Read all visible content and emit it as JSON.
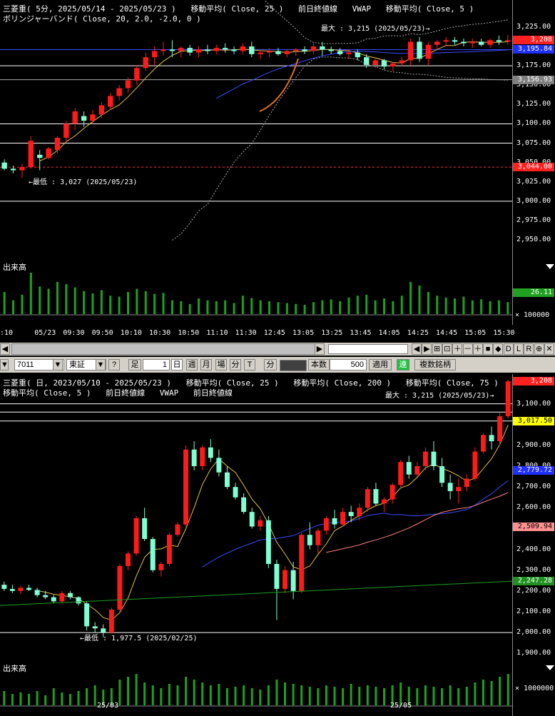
{
  "colors": {
    "up": "#ff1a1a",
    "down": "#7fffd4",
    "ma5": "#e6c050",
    "ma25": "#3a4cff",
    "ma75": "#ff8080",
    "ma200": "#1e9e1e",
    "vol": "#1ea01e",
    "axis": "#ffffff"
  },
  "top": {
    "header1": [
      "三菱重( 5分, 2025/05/14 - 2025/05/23 )",
      "移動平均( Close, 25 )",
      "前日終値線",
      "VWAP",
      "移動平均( Close, 5 )"
    ],
    "header2": "ボリンジャーバンド( Close, 20, 2.0, -2.0, 0 )",
    "max_note": "最大 : 3,215 (2025/05/23)→",
    "min_note": "←最低 : 3,027 (2025/05/23)",
    "yticks": [
      "3,225.00",
      "3,175.00",
      "3,150.00",
      "3,125.00",
      "3,100.00",
      "3,075.00",
      "3,050.00",
      "3,025.00",
      "3,000.00",
      "2,975.00",
      "2,950.00"
    ],
    "tags": [
      {
        "text": "3,208",
        "bg": "#ff2020",
        "fg": "#fff"
      },
      {
        "text": "3,195.84",
        "bg": "#2030ff",
        "fg": "#fff"
      },
      {
        "text": "3,156.93",
        "bg": "#808080",
        "fg": "#fff"
      },
      {
        "text": "3,044.00",
        "bg": "#ff2020",
        "fg": "#fff"
      }
    ],
    "xticks": [
      ":10",
      "05/23",
      "09:30",
      "09:50",
      "10:10",
      "10:30",
      "10:50",
      "11:10",
      "11:30",
      "12:45",
      "13:05",
      "13:25",
      "13:45",
      "14:05",
      "14:25",
      "14:45",
      "15:05",
      "15:30"
    ],
    "volume_label": "出来高",
    "volume_tag": "26.11",
    "volume_scale": "× 100000"
  },
  "toolbar": {
    "nav": [
      "◀",
      "▶",
      "⊞",
      "⊡",
      "＋",
      "－",
      "＋",
      "■",
      "◆",
      "D",
      "L",
      "R",
      "⊕",
      "✕"
    ],
    "code": "7011",
    "market": "東証",
    "help": "?",
    "ashi": "足",
    "count": "1",
    "day": "日",
    "week": "週",
    "month": "月",
    "ba": "場",
    "minute": "分",
    "tick": "T",
    "bun": "分",
    "honsu": "本数",
    "honsu_val": "500",
    "apply": "適用",
    "ren": "連",
    "multi": "複数銘柄"
  },
  "bottom": {
    "header1": [
      "三菱重( 日, 2023/05/10 - 2025/05/23 )",
      "移動平均( Close, 25 )",
      "移動平均( Close, 200 )",
      "移動平均( Close, 75 )"
    ],
    "header2": [
      "移動平均( Close, 5 )",
      "前日終値線",
      "VWAP",
      "前日終値線"
    ],
    "max_note": "最大 : 3,215 (2025/05/23)→",
    "min_note": "←最低 : 1,977.5 (2025/02/25)",
    "yticks": [
      "3,100.00",
      "2,900.00",
      "2,800.00",
      "2,700.00",
      "2,600.00",
      "2,500.00",
      "2,400.00",
      "2,300.00",
      "2,200.00",
      "2,100.00",
      "2,000.00",
      "1,900.00"
    ],
    "tags": [
      {
        "text": "3,208",
        "bg": "#ff2020",
        "fg": "#fff"
      },
      {
        "text": "3,017.50",
        "bg": "#ffff00",
        "fg": "#000"
      },
      {
        "text": "2,779.72",
        "bg": "#2030ff",
        "fg": "#fff"
      },
      {
        "text": "2,509.94",
        "bg": "#ff9090",
        "fg": "#000"
      },
      {
        "text": "2,247.28",
        "bg": "#209020",
        "fg": "#fff"
      }
    ],
    "xticks": [
      "25/03",
      "25/05"
    ],
    "volume_label": "出来高",
    "volume_scale": "× 1000000"
  },
  "chart_data": [
    {
      "type": "candlestick",
      "title": "三菱重( 5分, 2025/05/14 - 2025/05/23 )",
      "ylim": [
        2940,
        3235
      ],
      "ohlc": [
        [
          3050,
          3054,
          3040,
          3042
        ],
        [
          3042,
          3046,
          3036,
          3040
        ],
        [
          3040,
          3048,
          3030,
          3044
        ],
        [
          3044,
          3084,
          3042,
          3078
        ],
        [
          3060,
          3066,
          3040,
          3056
        ],
        [
          3056,
          3070,
          3054,
          3068
        ],
        [
          3066,
          3084,
          3062,
          3082
        ],
        [
          3082,
          3104,
          3076,
          3100
        ],
        [
          3100,
          3120,
          3092,
          3116
        ],
        [
          3110,
          3116,
          3096,
          3104
        ],
        [
          3104,
          3118,
          3100,
          3112
        ],
        [
          3112,
          3128,
          3108,
          3124
        ],
        [
          3122,
          3140,
          3118,
          3136
        ],
        [
          3136,
          3150,
          3130,
          3146
        ],
        [
          3146,
          3160,
          3140,
          3156
        ],
        [
          3156,
          3176,
          3150,
          3172
        ],
        [
          3172,
          3192,
          3168,
          3186
        ],
        [
          3186,
          3200,
          3176,
          3194
        ],
        [
          3194,
          3206,
          3188,
          3196
        ],
        [
          3196,
          3208,
          3186,
          3194
        ],
        [
          3194,
          3200,
          3186,
          3198
        ],
        [
          3198,
          3202,
          3188,
          3192
        ],
        [
          3192,
          3200,
          3186,
          3196
        ],
        [
          3196,
          3202,
          3190,
          3194
        ],
        [
          3194,
          3202,
          3190,
          3198
        ],
        [
          3198,
          3204,
          3192,
          3196
        ],
        [
          3196,
          3200,
          3190,
          3194
        ],
        [
          3194,
          3204,
          3190,
          3200
        ],
        [
          3200,
          3206,
          3186,
          3190
        ],
        [
          3190,
          3196,
          3184,
          3192
        ],
        [
          3192,
          3198,
          3186,
          3194
        ],
        [
          3194,
          3198,
          3188,
          3190
        ],
        [
          3190,
          3196,
          3186,
          3194
        ],
        [
          3194,
          3198,
          3188,
          3196
        ],
        [
          3196,
          3200,
          3190,
          3194
        ],
        [
          3194,
          3204,
          3190,
          3200
        ],
        [
          3200,
          3206,
          3188,
          3196
        ],
        [
          3196,
          3200,
          3190,
          3194
        ],
        [
          3194,
          3198,
          3188,
          3190
        ],
        [
          3190,
          3196,
          3184,
          3192
        ],
        [
          3192,
          3196,
          3182,
          3186
        ],
        [
          3186,
          3190,
          3172,
          3176
        ],
        [
          3176,
          3186,
          3172,
          3182
        ],
        [
          3182,
          3184,
          3170,
          3174
        ],
        [
          3174,
          3180,
          3168,
          3178
        ],
        [
          3178,
          3186,
          3174,
          3182
        ],
        [
          3182,
          3210,
          3176,
          3206
        ],
        [
          3206,
          3212,
          3180,
          3184
        ],
        [
          3184,
          3206,
          3176,
          3202
        ],
        [
          3202,
          3208,
          3196,
          3206
        ],
        [
          3206,
          3212,
          3200,
          3208
        ],
        [
          3208,
          3212,
          3202,
          3206
        ],
        [
          3206,
          3210,
          3200,
          3204
        ],
        [
          3204,
          3210,
          3198,
          3206
        ],
        [
          3206,
          3210,
          3200,
          3202
        ],
        [
          3202,
          3210,
          3198,
          3208
        ],
        [
          3208,
          3214,
          3202,
          3206
        ],
        [
          3206,
          3215,
          3202,
          3208
        ]
      ],
      "volume": [
        48,
        30,
        42,
        90,
        60,
        55,
        70,
        65,
        58,
        50,
        45,
        52,
        40,
        38,
        48,
        55,
        50,
        44,
        46,
        30,
        28,
        22,
        34,
        30,
        28,
        30,
        24,
        40,
        35,
        30,
        28,
        26,
        24,
        22,
        20,
        26,
        30,
        32,
        28,
        36,
        40,
        42,
        30,
        34,
        28,
        40,
        70,
        62,
        48,
        40,
        36,
        34,
        38,
        30,
        32,
        28,
        30,
        26
      ]
    },
    {
      "type": "candlestick",
      "title": "三菱重( 日, 2023/05/10 - 2025/05/23 )",
      "ylim": [
        1870,
        3140
      ],
      "ohlc": [
        [
          2230,
          2245,
          2200,
          2210
        ],
        [
          2210,
          2230,
          2190,
          2200
        ],
        [
          2200,
          2225,
          2185,
          2215
        ],
        [
          2215,
          2230,
          2200,
          2205
        ],
        [
          2205,
          2215,
          2170,
          2180
        ],
        [
          2180,
          2200,
          2160,
          2170
        ],
        [
          2170,
          2180,
          2140,
          2150
        ],
        [
          2150,
          2200,
          2140,
          2190
        ],
        [
          2190,
          2200,
          2160,
          2170
        ],
        [
          2170,
          2175,
          2130,
          2140
        ],
        [
          2140,
          2150,
          2010,
          2030
        ],
        [
          2030,
          2050,
          2000,
          2020
        ],
        [
          2020,
          2040,
          1977,
          2000
        ],
        [
          2000,
          2120,
          1995,
          2110
        ],
        [
          2110,
          2330,
          2100,
          2320
        ],
        [
          2320,
          2390,
          2300,
          2380
        ],
        [
          2380,
          2560,
          2370,
          2550
        ],
        [
          2550,
          2600,
          2440,
          2450
        ],
        [
          2450,
          2460,
          2290,
          2300
        ],
        [
          2300,
          2340,
          2270,
          2330
        ],
        [
          2330,
          2480,
          2320,
          2470
        ],
        [
          2470,
          2530,
          2460,
          2520
        ],
        [
          2520,
          2900,
          2510,
          2880
        ],
        [
          2880,
          2920,
          2780,
          2800
        ],
        [
          2800,
          2900,
          2780,
          2890
        ],
        [
          2890,
          2930,
          2820,
          2840
        ],
        [
          2840,
          2880,
          2750,
          2770
        ],
        [
          2770,
          2800,
          2690,
          2700
        ],
        [
          2700,
          2720,
          2640,
          2650
        ],
        [
          2650,
          2670,
          2570,
          2580
        ],
        [
          2580,
          2600,
          2500,
          2510
        ],
        [
          2510,
          2560,
          2490,
          2540
        ],
        [
          2540,
          2560,
          2310,
          2330
        ],
        [
          2330,
          2350,
          2060,
          2210
        ],
        [
          2210,
          2320,
          2190,
          2300
        ],
        [
          2300,
          2340,
          2160,
          2200
        ],
        [
          2200,
          2480,
          2190,
          2470
        ],
        [
          2470,
          2530,
          2400,
          2420
        ],
        [
          2420,
          2500,
          2380,
          2490
        ],
        [
          2490,
          2560,
          2470,
          2550
        ],
        [
          2550,
          2590,
          2500,
          2520
        ],
        [
          2520,
          2600,
          2510,
          2580
        ],
        [
          2580,
          2610,
          2530,
          2560
        ],
        [
          2560,
          2620,
          2540,
          2600
        ],
        [
          2600,
          2700,
          2580,
          2690
        ],
        [
          2690,
          2720,
          2610,
          2620
        ],
        [
          2620,
          2650,
          2580,
          2640
        ],
        [
          2640,
          2720,
          2620,
          2710
        ],
        [
          2710,
          2830,
          2700,
          2820
        ],
        [
          2820,
          2850,
          2740,
          2760
        ],
        [
          2760,
          2820,
          2750,
          2800
        ],
        [
          2800,
          2890,
          2780,
          2870
        ],
        [
          2870,
          2920,
          2780,
          2800
        ],
        [
          2800,
          2840,
          2700,
          2720
        ],
        [
          2720,
          2760,
          2640,
          2680
        ],
        [
          2680,
          2740,
          2620,
          2700
        ],
        [
          2700,
          2760,
          2680,
          2740
        ],
        [
          2740,
          2890,
          2730,
          2870
        ],
        [
          2870,
          2960,
          2860,
          2950
        ],
        [
          2950,
          2990,
          2880,
          2920
        ],
        [
          2920,
          3060,
          2900,
          3040
        ],
        [
          3040,
          3215,
          3030,
          3208
        ]
      ],
      "volume": [
        10,
        8,
        9,
        8,
        10,
        7,
        12,
        9,
        8,
        10,
        12,
        14,
        11,
        12,
        18,
        20,
        22,
        16,
        14,
        12,
        15,
        14,
        20,
        18,
        16,
        14,
        15,
        12,
        13,
        14,
        12,
        11,
        14,
        18,
        16,
        15,
        14,
        13,
        12,
        14,
        13,
        12,
        15,
        13,
        14,
        13,
        12,
        14,
        16,
        13,
        12,
        14,
        13,
        12,
        14,
        12,
        13,
        16,
        18,
        17,
        20,
        22
      ]
    }
  ]
}
